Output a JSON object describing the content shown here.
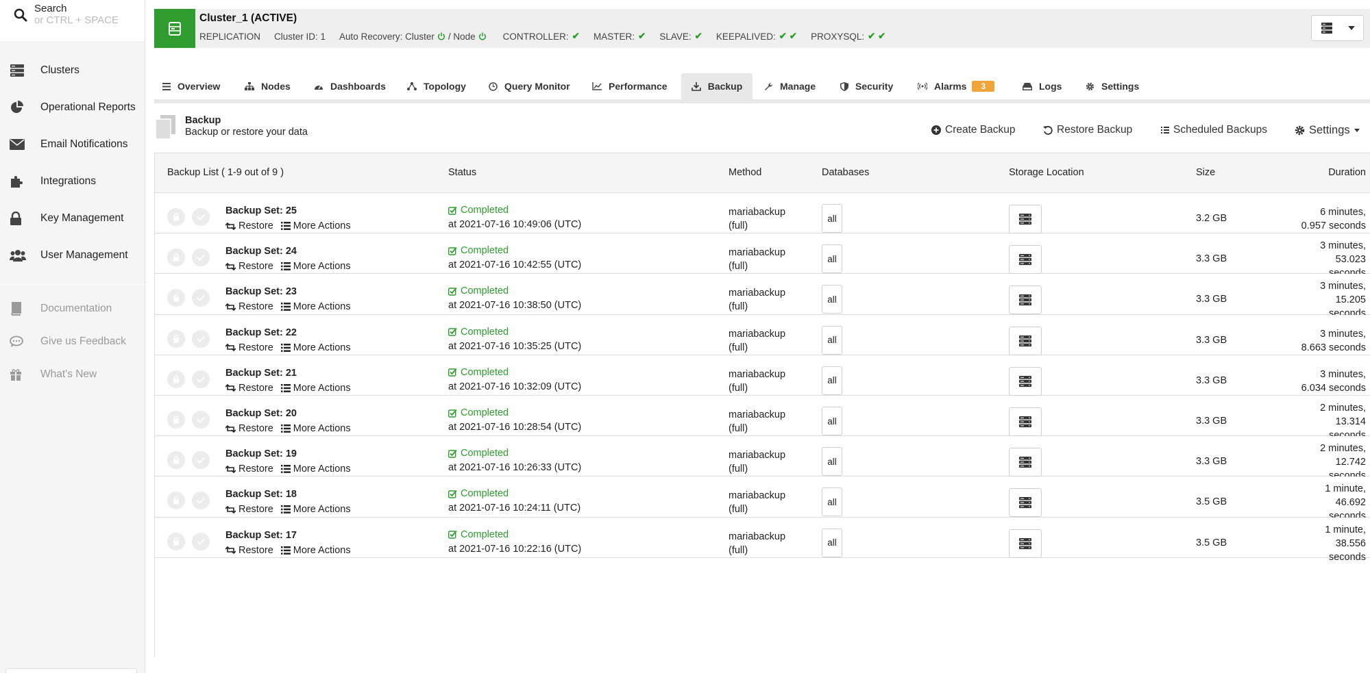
{
  "search": {
    "label": "Search",
    "hint": "or CTRL + SPACE"
  },
  "sidebar": {
    "items": [
      {
        "label": "Clusters",
        "icon": "servers-icon"
      },
      {
        "label": "Operational Reports",
        "icon": "pie-chart-icon"
      },
      {
        "label": "Email Notifications",
        "icon": "envelope-icon"
      },
      {
        "label": "Integrations",
        "icon": "puzzle-icon"
      },
      {
        "label": "Key Management",
        "icon": "lock-icon"
      },
      {
        "label": "User Management",
        "icon": "users-icon"
      }
    ],
    "secondary": [
      {
        "label": "Documentation",
        "icon": "book-icon"
      },
      {
        "label": "Give us Feedback",
        "icon": "comment-icon"
      },
      {
        "label": "What's New",
        "icon": "gift-icon"
      }
    ]
  },
  "cluster": {
    "name": "Cluster_1 (ACTIVE)",
    "type": "REPLICATION",
    "id_text": "Cluster ID: 1",
    "recovery_label": "Auto Recovery: Cluster",
    "recovery_node": "/ Node",
    "controller": "CONTROLLER:",
    "master": "MASTER:",
    "slave": "SLAVE:",
    "keepalived": "KEEPALIVED:",
    "proxysql": "PROXYSQL:",
    "check": "✔",
    "check2": "✔ ✔"
  },
  "tabs": [
    {
      "label": "Overview",
      "icon": "list-icon"
    },
    {
      "label": "Nodes",
      "icon": "sitemap-icon"
    },
    {
      "label": "Dashboards",
      "icon": "tachometer-icon"
    },
    {
      "label": "Topology",
      "icon": "topology-icon"
    },
    {
      "label": "Query Monitor",
      "icon": "clock-icon"
    },
    {
      "label": "Performance",
      "icon": "line-chart-icon"
    },
    {
      "label": "Backup",
      "icon": "download-icon",
      "active": true
    },
    {
      "label": "Manage",
      "icon": "wrench-icon"
    },
    {
      "label": "Security",
      "icon": "shield-icon"
    },
    {
      "label": "Alarms",
      "icon": "broadcast-icon",
      "badge": "3"
    },
    {
      "label": "Logs",
      "icon": "hdd-icon"
    },
    {
      "label": "Settings",
      "icon": "gear-icon"
    }
  ],
  "section": {
    "title": "Backup",
    "subtitle": "Backup or restore your data",
    "actions": {
      "create": "Create Backup",
      "restore": "Restore Backup",
      "scheduled": "Scheduled Backups",
      "settings": "Settings"
    }
  },
  "table": {
    "headers": {
      "list": "Backup List ( 1-9 out of 9 )",
      "status": "Status",
      "method": "Method",
      "databases": "Databases",
      "storage": "Storage Location",
      "size": "Size",
      "duration": "Duration"
    },
    "row_links": {
      "restore": "Restore",
      "more": "More Actions"
    },
    "rows": [
      {
        "name": "Backup Set: 25",
        "status": "Completed",
        "time": "at 2021-07-16 10:49:06 (UTC)",
        "method": "mariabackup",
        "method_type": "(full)",
        "db": "all",
        "size": "3.2 GB",
        "duration": [
          "6 minutes,",
          "0.957 seconds"
        ]
      },
      {
        "name": "Backup Set: 24",
        "status": "Completed",
        "time": "at 2021-07-16 10:42:55 (UTC)",
        "method": "mariabackup",
        "method_type": "(full)",
        "db": "all",
        "size": "3.3 GB",
        "duration": [
          "3 minutes,",
          "53.023",
          "seconds"
        ]
      },
      {
        "name": "Backup Set: 23",
        "status": "Completed",
        "time": "at 2021-07-16 10:38:50 (UTC)",
        "method": "mariabackup",
        "method_type": "(full)",
        "db": "all",
        "size": "3.3 GB",
        "duration": [
          "3 minutes,",
          "15.205",
          "seconds"
        ]
      },
      {
        "name": "Backup Set: 22",
        "status": "Completed",
        "time": "at 2021-07-16 10:35:25 (UTC)",
        "method": "mariabackup",
        "method_type": "(full)",
        "db": "all",
        "size": "3.3 GB",
        "duration": [
          "3 minutes,",
          "8.663 seconds"
        ]
      },
      {
        "name": "Backup Set: 21",
        "status": "Completed",
        "time": "at 2021-07-16 10:32:09 (UTC)",
        "method": "mariabackup",
        "method_type": "(full)",
        "db": "all",
        "size": "3.3 GB",
        "duration": [
          "3 minutes,",
          "6.034 seconds"
        ]
      },
      {
        "name": "Backup Set: 20",
        "status": "Completed",
        "time": "at 2021-07-16 10:28:54 (UTC)",
        "method": "mariabackup",
        "method_type": "(full)",
        "db": "all",
        "size": "3.3 GB",
        "duration": [
          "2 minutes,",
          "13.314",
          "seconds"
        ]
      },
      {
        "name": "Backup Set: 19",
        "status": "Completed",
        "time": "at 2021-07-16 10:26:33 (UTC)",
        "method": "mariabackup",
        "method_type": "(full)",
        "db": "all",
        "size": "3.3 GB",
        "duration": [
          "2 minutes,",
          "12.742",
          "seconds"
        ]
      },
      {
        "name": "Backup Set: 18",
        "status": "Completed",
        "time": "at 2021-07-16 10:24:11 (UTC)",
        "method": "mariabackup",
        "method_type": "(full)",
        "db": "all",
        "size": "3.5 GB",
        "duration": [
          "1 minute,",
          "46.692",
          "seconds"
        ]
      },
      {
        "name": "Backup Set: 17",
        "status": "Completed",
        "time": "at 2021-07-16 10:22:16 (UTC)",
        "method": "mariabackup",
        "method_type": "(full)",
        "db": "all",
        "size": "3.5 GB",
        "duration": [
          "1 minute,",
          "38.556",
          "seconds"
        ]
      }
    ]
  },
  "colors": {
    "success": "#2e9c2e",
    "badge": "#f0a53a",
    "sidebar_bg": "#f5f5f5"
  }
}
